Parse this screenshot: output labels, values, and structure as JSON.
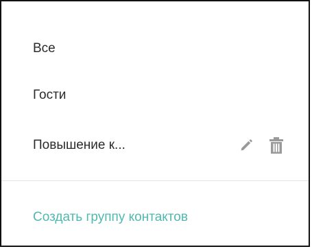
{
  "groups_menu": {
    "items": [
      {
        "label": "Все"
      },
      {
        "label": "Гости"
      },
      {
        "label": "Повышение к..."
      }
    ],
    "create_group_label": "Создать группу контактов",
    "icons": {
      "edit": "pencil-icon",
      "delete": "trash-icon"
    },
    "colors": {
      "text": "#2b2b2b",
      "link": "#4fb9b0",
      "icon": "#9a9a9a",
      "divider": "#e3e3e3"
    }
  }
}
